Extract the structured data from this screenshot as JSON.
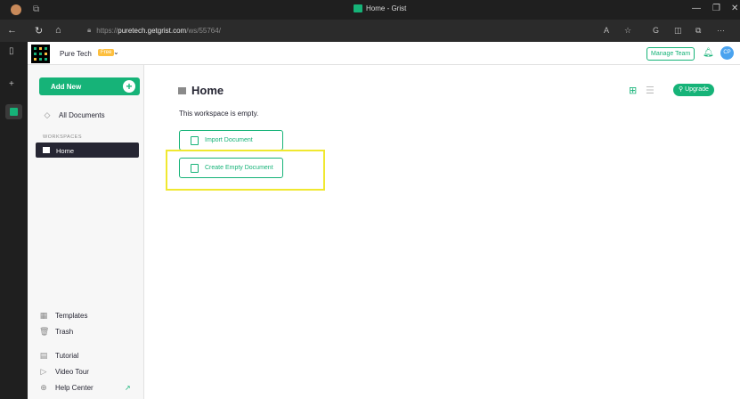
{
  "browser": {
    "window_title": "Home - Grist",
    "url_prefix": "https://",
    "url_host": "puretech.getgrist.com",
    "url_path": "/ws/55764/",
    "colors": {
      "chrome": "#1f1f1f",
      "addressbar": "#2b2b2b"
    }
  },
  "org": {
    "name": "Pure Tech",
    "plan_badge": "Free"
  },
  "sidebar": {
    "add_new_label": "Add New",
    "all_documents_label": "All Documents",
    "workspaces_heading": "WORKSPACES",
    "workspaces": [
      {
        "name": "Home",
        "selected": true
      }
    ],
    "bottom_links": [
      {
        "label": "Templates",
        "icon": "templates-icon"
      },
      {
        "label": "Trash",
        "icon": "trash-icon"
      },
      {
        "label": "Tutorial",
        "icon": "tutorial-icon"
      },
      {
        "label": "Video Tour",
        "icon": "video-icon"
      },
      {
        "label": "Help Center",
        "icon": "help-icon"
      }
    ]
  },
  "topbar": {
    "manage_team_label": "Manage Team",
    "avatar_initials": "CP"
  },
  "main": {
    "title": "Home",
    "empty_message": "This workspace is empty.",
    "import_document_label": "Import Document",
    "create_empty_document_label": "Create Empty Document",
    "upgrade_label": "Upgrade"
  },
  "colors": {
    "accent": "#16b378",
    "highlight": "#f0e830",
    "plan_badge": "#fdbf3e",
    "avatar": "#4aa3ef"
  }
}
